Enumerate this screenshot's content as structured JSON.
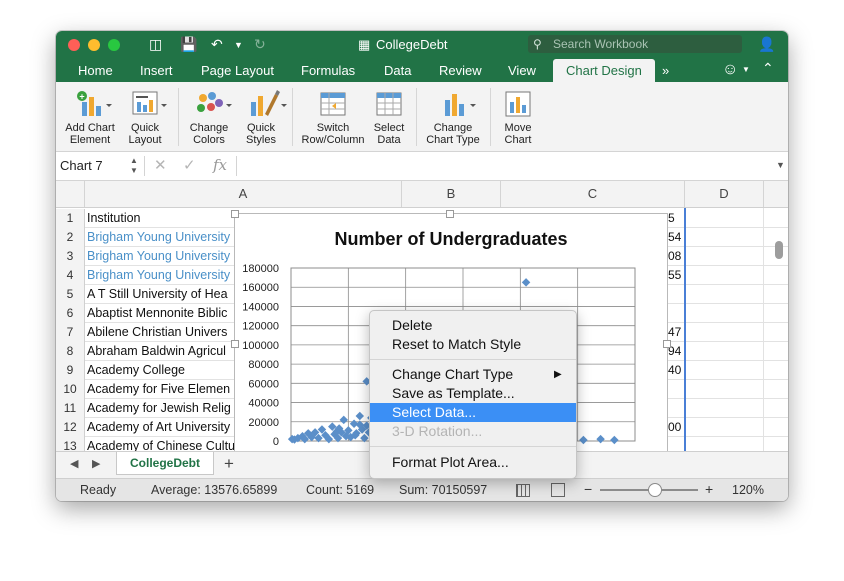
{
  "window": {
    "title": "CollegeDebt",
    "search_placeholder": "Search Workbook"
  },
  "ribbon_tabs": [
    "Home",
    "Insert",
    "Page Layout",
    "Formulas",
    "Data",
    "Review",
    "View",
    "Chart Design"
  ],
  "active_tab": "Chart Design",
  "ribbon_buttons": {
    "add_chart_element": "Add Chart\nElement",
    "quick_layout": "Quick\nLayout",
    "change_colors": "Change\nColors",
    "quick_styles": "Quick\nStyles",
    "switch_row_column": "Switch\nRow/Column",
    "select_data": "Select\nData",
    "change_chart_type": "Change\nChart Type",
    "move_chart": "Move\nChart"
  },
  "formula_bar": {
    "name_box": "Chart 7",
    "fx": "fx",
    "value": ""
  },
  "columns": [
    "A",
    "B",
    "C",
    "D"
  ],
  "rows": [
    {
      "num": "1",
      "institution": "Institution",
      "link": false
    },
    {
      "num": "2",
      "institution": "Brigham Young University",
      "link": true
    },
    {
      "num": "3",
      "institution": "Brigham Young University",
      "link": true
    },
    {
      "num": "4",
      "institution": "Brigham Young University",
      "link": true
    },
    {
      "num": "5",
      "institution": "A T Still University of Hea",
      "link": false
    },
    {
      "num": "6",
      "institution": "Abaptist Mennonite Biblic",
      "link": false
    },
    {
      "num": "7",
      "institution": "Abilene Christian Univers",
      "link": false
    },
    {
      "num": "8",
      "institution": "Abraham Baldwin Agricul",
      "link": false
    },
    {
      "num": "9",
      "institution": "Academy College",
      "link": false
    },
    {
      "num": "10",
      "institution": "Academy for Five Elemen",
      "link": false
    },
    {
      "num": "11",
      "institution": "Academy for Jewish Relig",
      "link": false
    },
    {
      "num": "12",
      "institution": "Academy of Art University",
      "link": false
    },
    {
      "num": "13",
      "institution": "Academy of Chinese Cultu",
      "link": false
    }
  ],
  "col_c_fragments": [
    {
      "row": 1,
      "text": "5"
    },
    {
      "row": 2,
      "text": "54"
    },
    {
      "row": 3,
      "text": "08"
    },
    {
      "row": 4,
      "text": "55"
    },
    {
      "row": 7,
      "text": "47"
    },
    {
      "row": 8,
      "text": "94"
    },
    {
      "row": 9,
      "text": "40"
    },
    {
      "row": 12,
      "text": "00"
    }
  ],
  "chart_data": {
    "type": "scatter",
    "title": "Number of Undergraduates",
    "ylim": [
      0,
      180000
    ],
    "yticks": [
      "180000",
      "160000",
      "140000",
      "120000",
      "100000",
      "80000",
      "60000",
      "40000",
      "20000",
      "0"
    ],
    "grid": true,
    "series": [
      {
        "color": "#5b8fc9",
        "points": [
          [
            1,
            2000
          ],
          [
            3,
            1500
          ],
          [
            6,
            3000
          ],
          [
            10,
            5000
          ],
          [
            12,
            2000
          ],
          [
            15,
            8000
          ],
          [
            18,
            4000
          ],
          [
            21,
            9000
          ],
          [
            24,
            3000
          ],
          [
            27,
            12000
          ],
          [
            30,
            6000
          ],
          [
            33,
            2000
          ],
          [
            36,
            15000
          ],
          [
            38,
            7000
          ],
          [
            41,
            3000
          ],
          [
            44,
            9000
          ],
          [
            46,
            22000
          ],
          [
            48,
            5000
          ],
          [
            50,
            11000
          ],
          [
            52,
            4000
          ],
          [
            55,
            18000
          ],
          [
            57,
            8000
          ],
          [
            60,
            26000
          ],
          [
            62,
            12000
          ],
          [
            64,
            3000
          ],
          [
            66,
            16000
          ],
          [
            68,
            9000
          ],
          [
            70,
            24000
          ],
          [
            72,
            5000
          ],
          [
            74,
            13000
          ],
          [
            76,
            19000
          ],
          [
            78,
            7000
          ],
          [
            80,
            27000
          ],
          [
            82,
            10000
          ],
          [
            84,
            4000
          ],
          [
            86,
            14000
          ],
          [
            88,
            33000
          ],
          [
            90,
            11000
          ],
          [
            92,
            6000
          ],
          [
            94,
            21000
          ],
          [
            96,
            15000
          ],
          [
            98,
            9000
          ],
          [
            100,
            3000
          ],
          [
            102,
            18000
          ],
          [
            104,
            12000
          ],
          [
            106,
            6000
          ],
          [
            108,
            9000
          ],
          [
            110,
            4000
          ],
          [
            112,
            7000
          ],
          [
            114,
            2000
          ],
          [
            117,
            5000
          ],
          [
            120,
            3000
          ],
          [
            123,
            6000
          ],
          [
            126,
            2000
          ],
          [
            130,
            4000
          ],
          [
            135,
            2000
          ],
          [
            140,
            3000
          ],
          [
            148,
            2000
          ],
          [
            155,
            1000
          ],
          [
            162,
            2000
          ],
          [
            170,
            1500
          ],
          [
            180,
            1000
          ],
          [
            190,
            2000
          ],
          [
            200,
            1000
          ],
          [
            210,
            1500
          ],
          [
            220,
            1000
          ],
          [
            240,
            1500
          ],
          [
            255,
            1000
          ],
          [
            270,
            2000
          ],
          [
            282,
            1000
          ],
          [
            40,
            10000
          ],
          [
            56,
            6000
          ],
          [
            77,
            30000
          ],
          [
            82,
            39000
          ],
          [
            66,
            62000
          ],
          [
            87,
            36000
          ],
          [
            60,
            17000
          ],
          [
            42,
            13000
          ],
          [
            95,
            28000
          ],
          [
            205,
            165000
          ]
        ]
      }
    ]
  },
  "context_menu": {
    "items": [
      {
        "label": "Delete",
        "state": "normal"
      },
      {
        "label": "Reset to Match Style",
        "state": "normal"
      },
      {
        "label": "Change Chart Type",
        "state": "normal",
        "submenu": true
      },
      {
        "label": "Save as Template...",
        "state": "normal"
      },
      {
        "label": "Select Data...",
        "state": "selected"
      },
      {
        "label": "3-D Rotation...",
        "state": "disabled"
      },
      {
        "label": "Format Plot Area...",
        "state": "normal"
      }
    ]
  },
  "sheet_tab": "CollegeDebt",
  "status": {
    "ready": "Ready",
    "average": "Average: 13576.65899",
    "count": "Count: 5169",
    "sum": "Sum: 70150597",
    "zoom": "120%",
    "zoom_level": 0.55
  },
  "colors": {
    "excel_green": "#217346",
    "selection_blue": "#3b8ff5",
    "link_blue": "#4a90c8",
    "marker_blue": "#5b8fc9"
  }
}
